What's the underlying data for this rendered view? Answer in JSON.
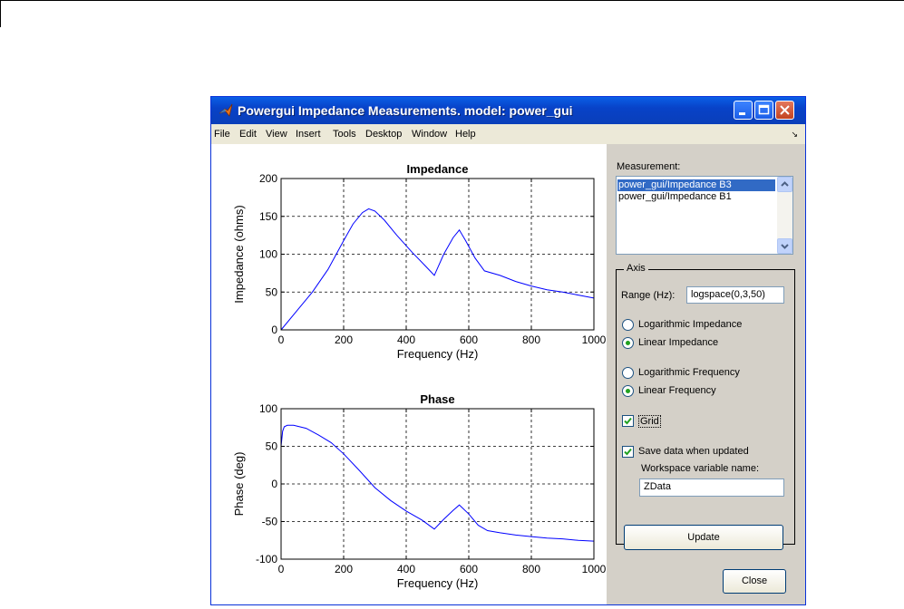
{
  "window": {
    "title": "Powergui Impedance Measurements. model: power_gui"
  },
  "menu": [
    "File",
    "Edit",
    "View",
    "Insert",
    "Tools",
    "Desktop",
    "Window",
    "Help"
  ],
  "panel": {
    "measurement_label": "Measurement:",
    "measurements": [
      "power_gui/Impedance B3",
      "power_gui/Impedance B1"
    ],
    "selected_index": 0,
    "axis_group_title": "Axis",
    "range_label": "Range (Hz):",
    "range_value": "logspace(0,3,50)",
    "impedance_options": [
      "Logarithmic Impedance",
      "Linear Impedance"
    ],
    "impedance_selected": "Linear Impedance",
    "frequency_options": [
      "Logarithmic Frequency",
      "Linear Frequency"
    ],
    "frequency_selected": "Linear Frequency",
    "grid_label": "Grid",
    "grid_checked": true,
    "save_label": "Save data when updated",
    "save_checked": true,
    "workspace_label": "Workspace variable name:",
    "workspace_value": "ZData",
    "update_label": "Update",
    "close_label": "Close"
  },
  "chart_data": [
    {
      "type": "line",
      "title": "Impedance",
      "xlabel": "Frequency (Hz)",
      "ylabel": "Impedance (ohms)",
      "xlim": [
        0,
        1000
      ],
      "ylim": [
        0,
        200
      ],
      "xticks": [
        "0",
        "200",
        "400",
        "600",
        "800",
        "1000"
      ],
      "yticks": [
        "0",
        "50",
        "100",
        "150",
        "200"
      ],
      "grid": true,
      "color": "#0000ff",
      "x": [
        0,
        50,
        100,
        150,
        200,
        230,
        260,
        280,
        300,
        330,
        370,
        420,
        460,
        490,
        520,
        550,
        570,
        590,
        620,
        650,
        700,
        750,
        800,
        850,
        900,
        950,
        1000
      ],
      "y": [
        0,
        25,
        50,
        80,
        118,
        140,
        155,
        160,
        157,
        145,
        125,
        102,
        85,
        72,
        100,
        122,
        132,
        118,
        95,
        78,
        72,
        64,
        58,
        53,
        50,
        46,
        42
      ]
    },
    {
      "type": "line",
      "title": "Phase",
      "xlabel": "Frequency (Hz)",
      "ylabel": "Phase (deg)",
      "xlim": [
        0,
        1000
      ],
      "ylim": [
        -100,
        100
      ],
      "xticks": [
        "0",
        "200",
        "400",
        "600",
        "800",
        "1000"
      ],
      "yticks": [
        "-100",
        "-50",
        "0",
        "50",
        "100"
      ],
      "grid": true,
      "color": "#0000ff",
      "x": [
        0,
        5,
        10,
        20,
        40,
        80,
        120,
        160,
        200,
        250,
        300,
        350,
        400,
        450,
        490,
        520,
        550,
        570,
        600,
        630,
        660,
        700,
        750,
        800,
        850,
        900,
        950,
        1000
      ],
      "y": [
        50,
        70,
        76,
        78,
        78,
        74,
        65,
        55,
        40,
        18,
        -5,
        -22,
        -36,
        -48,
        -60,
        -47,
        -35,
        -28,
        -40,
        -55,
        -62,
        -65,
        -68,
        -70,
        -72,
        -73,
        -75,
        -76
      ]
    }
  ]
}
